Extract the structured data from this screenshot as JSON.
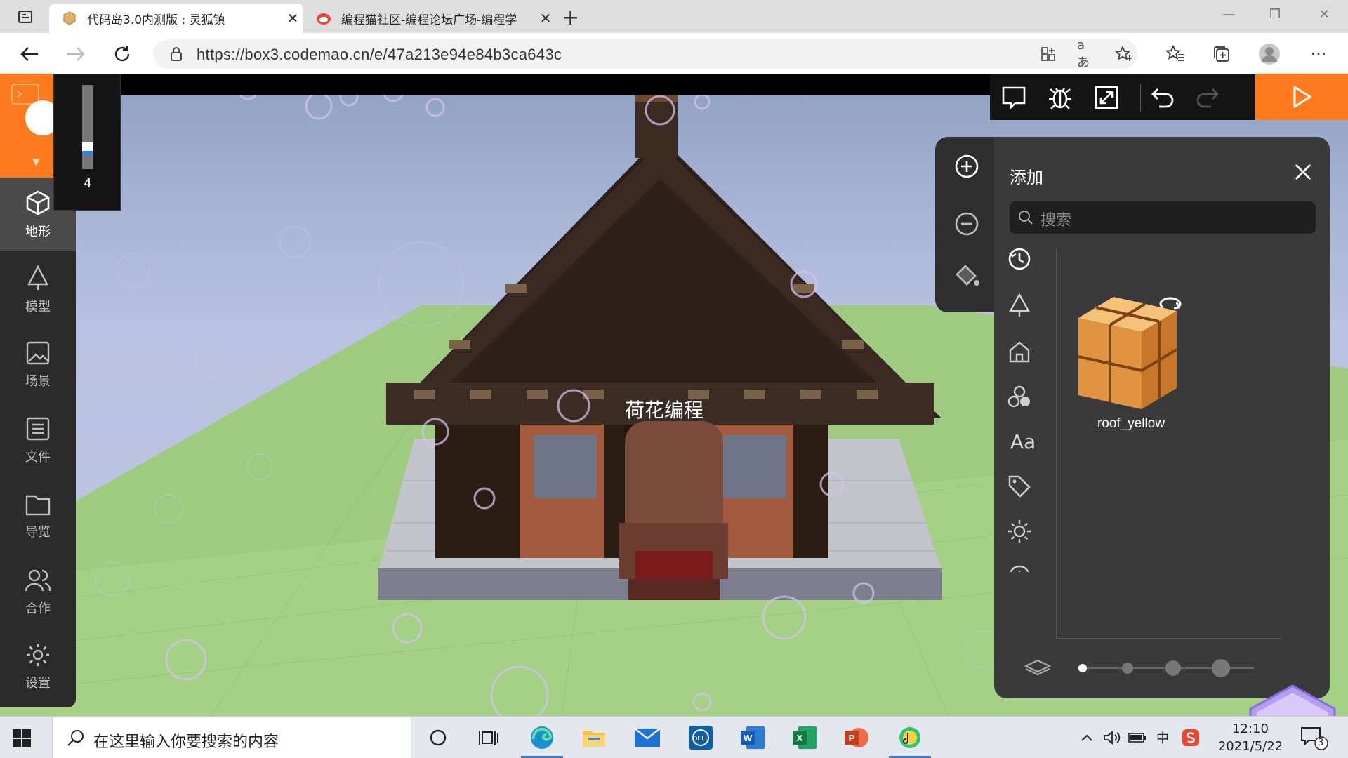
{
  "browser": {
    "tabs": [
      {
        "title": "代码岛3.0内测版 : 灵狐镇",
        "active": true
      },
      {
        "title": "编程猫社区-编程论坛广场-编程学",
        "active": false
      }
    ],
    "url": "https://box3.codemao.cn/e/47a213e94e84b3ca643c"
  },
  "sidebar": {
    "items": [
      {
        "label": "地形",
        "icon": "cube-icon",
        "active": true
      },
      {
        "label": "模型",
        "icon": "tree-icon",
        "active": false
      },
      {
        "label": "场景",
        "icon": "image-icon",
        "active": false
      },
      {
        "label": "文件",
        "icon": "file-list-icon",
        "active": false
      },
      {
        "label": "导览",
        "icon": "folder-icon",
        "active": false
      },
      {
        "label": "合作",
        "icon": "users-icon",
        "active": false
      },
      {
        "label": "设置",
        "icon": "gear-icon",
        "active": false
      }
    ]
  },
  "brush": {
    "value": "4"
  },
  "scene": {
    "character_label": "荷花编程"
  },
  "add_panel": {
    "title": "添加",
    "search_placeholder": "搜索",
    "asset": {
      "name": "roof_yellow"
    }
  },
  "taskbar": {
    "search_placeholder": "在这里输入你要搜索的内容",
    "time": "12:10",
    "date": "2021/5/22",
    "ime": "中",
    "notifications": "3"
  },
  "colors": {
    "accent": "#ff7a1c",
    "panel": "#3a3a3a",
    "dark": "#2b2b2b"
  }
}
